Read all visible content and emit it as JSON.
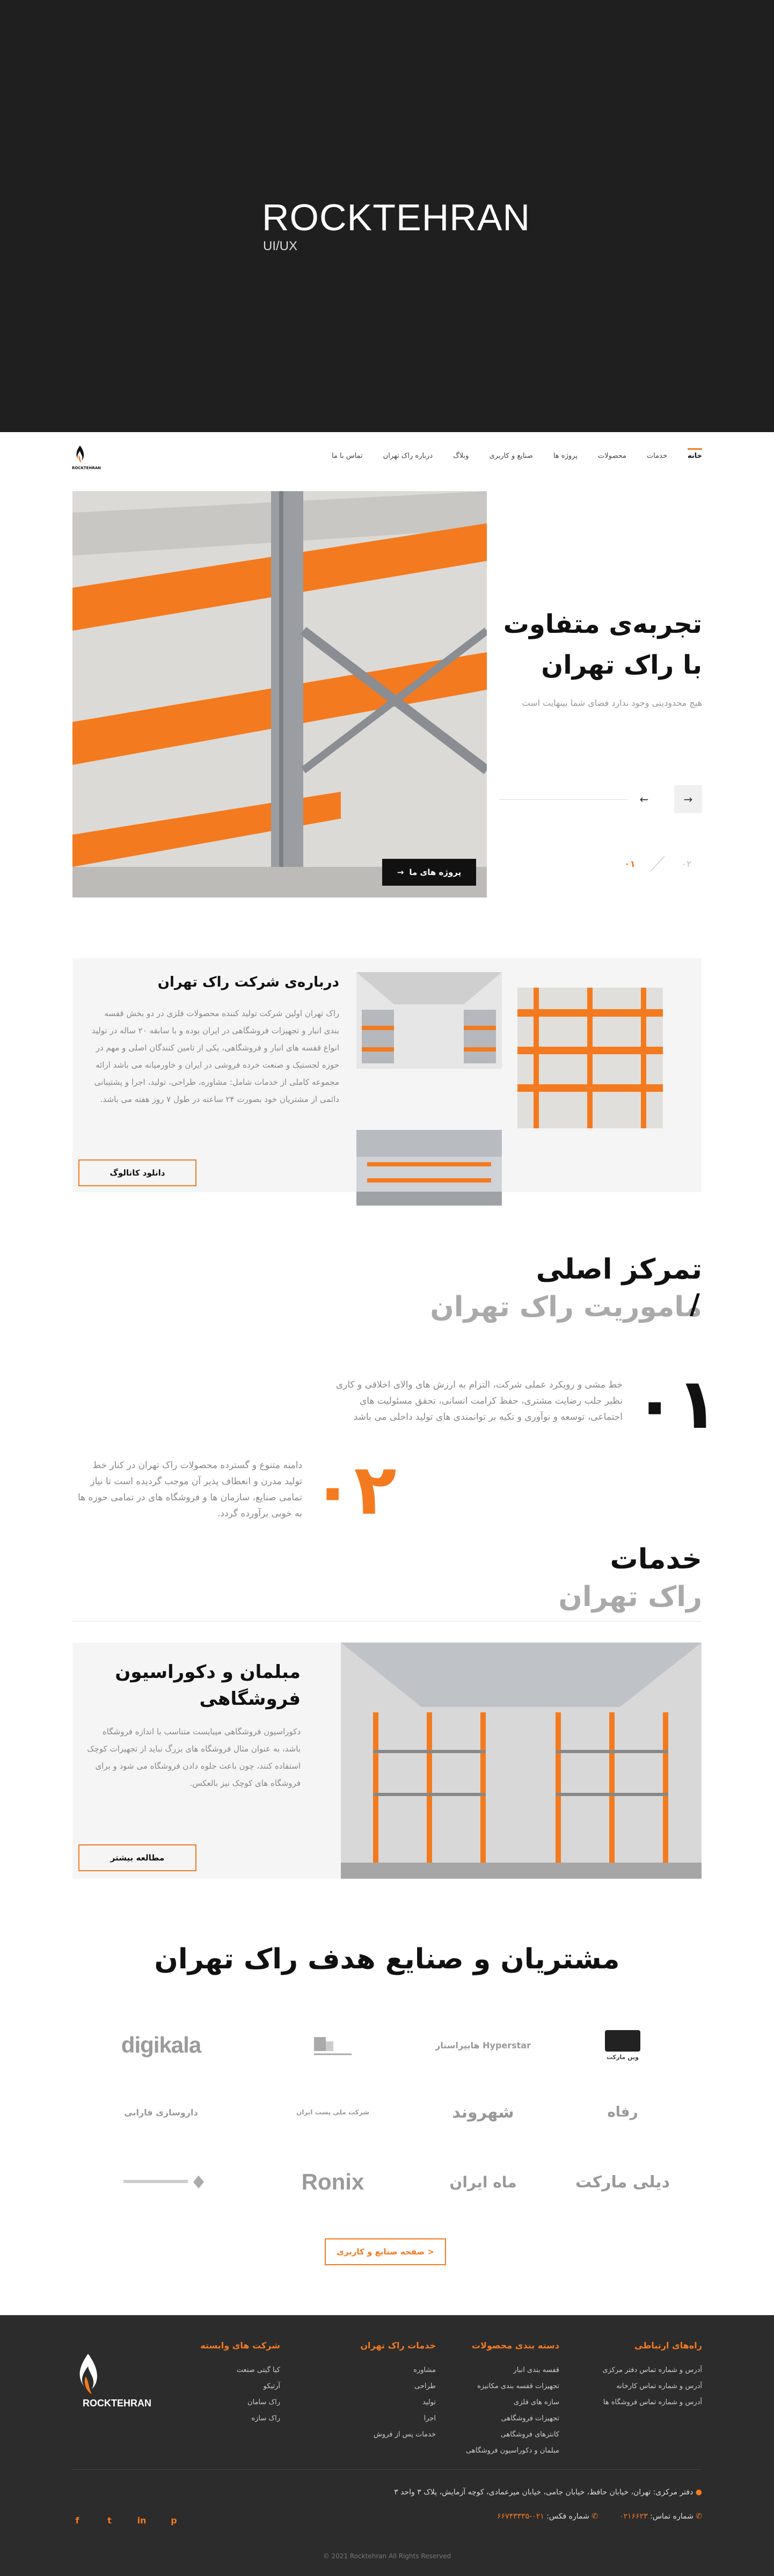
{
  "cover": {
    "title": "ROCKTEHRAN",
    "subtitle": "UI/UX"
  },
  "logo": {
    "text": "ROCKTEHRAN"
  },
  "nav": {
    "items": [
      "خانه",
      "خدمات",
      "محصولات",
      "پروژه ها",
      "صنایع و کاربری",
      "وبلاگ",
      "درباره راک تهران",
      "تماس با ما"
    ]
  },
  "hero": {
    "title_line1": "تجربه‌ی متفاوت",
    "title_line2": "با راک تهران",
    "desc": "هیچ محدودیتی وجود ندارد فضای شما بینهایت است",
    "project_button": "پروژه های ما",
    "pager_active": "۰۱",
    "pager_next": "۰۲",
    "arrow_next": "→",
    "arrow_prev": "←"
  },
  "about": {
    "title": "درباره‌ی شرکت راک تهران",
    "text": "راک تهران اولین شرکت تولید کننده محصولات فلزی در دو بخش قفسه بندی انبار و تجهیزات فروشگاهی در ایران بوده و با سابقه ۲۰ ساله در تولید انواع قفسه های انبار و فروشگاهی، یکی از تامین کنندگان اصلی و مهم در حوزه لجستیک و صنعت خرده فروشی در ایران و خاورمیانه می باشد ارائه مجموعه کاملی از خدمات شامل: مشاوره، طراحی، تولید، اجرا و پشتیبانی دائمی از مشتریان خود بصورت ۲۴ ساعته در طول ۷ روز هفته می باشد.",
    "catalog_button": "دانلود کاتالوگ"
  },
  "mission": {
    "title_line1": "تمرکز اصلی",
    "title_line2": "ماموریت راک تهران",
    "slash": "/",
    "num1": "۰۱",
    "text1": "خط مشی و رویکرد عملی شرکت، التزام به ارزش های والای اخلاقی و کاری نظیر جلب رضایت مشتری، حفظ کرامت انسانی، تحقق مسئولیت های اجتماعی، توسعه و نوآوری و تکیه بر توانمندی های تولید داخلی می باشد",
    "num2": "۰۲",
    "text2": "دامنه متنوع و گسترده محصولات راک تهران در کنار خط تولید مدرن و انعطاف پذیر آن موجب گردیده است تا نیاز تمامی صنایع، سازمان ها و فروشگاه های در تمامی حوزه ها به خوبی برآورده گردد."
  },
  "services": {
    "title_line1": "خدمات",
    "title_line2": "راک تهران",
    "card_title": "مبلمان و دکوراسیون فروشگاهی",
    "card_desc": "دکوراسیون فروشگاهی میبایست متناسب با اندازه فروشگاه باشد، به عنوان مثال فروشگاه های بزرگ نباید از تجهیزات کوچک استفاده کنند، چون باعث جلوه دادن فروشگاه می شود و برای فروشگاه های کوچک نیز بالعکس.",
    "more_button": "مطالعه بیشتر"
  },
  "clients": {
    "title": "مشتریان و صنایع هدف راک تهران",
    "logos": [
      "وین مارکت",
      "هایپراستار Hyperstar",
      "",
      "digikala",
      "رفاه",
      "شهروند",
      "شرکت ملی پست ایران",
      "داروسازی فارابی",
      "دیلی مارکت",
      "ماه ایران",
      "Ronix",
      ""
    ],
    "all_button": "صفحه صنایع و کاربری >"
  },
  "footer": {
    "col1": {
      "title": "راه‌های ارتباطی",
      "items": [
        "آدرس و شماره تماس دفتر مرکزی",
        "آدرس و شماره تماس کارخانه",
        "آدرس و شماره تماس فروشگاه ها"
      ]
    },
    "col2": {
      "title": "دسته بندی محصولات",
      "items": [
        "قفسه بندی انبار",
        "تجهیزات قفسه بندی مکانیزه",
        "سازه های فلزی",
        "تجهیزات فروشگاهی",
        "کانترهای فروشگاهی",
        "مبلمان و دکوراسیون فروشگاهی"
      ]
    },
    "col3": {
      "title": "خدمات راک تهران",
      "items": [
        "مشاوره",
        "طراحی",
        "تولید",
        "اجرا",
        "خدمات پس از فروش"
      ]
    },
    "col4": {
      "title": "شرکت های وابسته",
      "items": [
        "کیا گیتی صنعت",
        "آرتیکو",
        "راک سامان",
        "راک سازه"
      ]
    },
    "address": "دفتر مرکزی: تهران، خیابان حافظ، خیابان جامی، خیابان میرعمادی، کوچه آزمایش، پلاک ۳ واحد ۳",
    "phone_label": "شماره تماس:",
    "phone": "۰۲۱۶۶۲۳",
    "fax_label": "شماره فکس:",
    "fax": "۰۲۱-۶۶۷۴۳۳۳۵",
    "social": [
      "f",
      "t",
      "in",
      "p"
    ],
    "copyright": "© 2021 Rocktehran All Rights Reserved"
  }
}
